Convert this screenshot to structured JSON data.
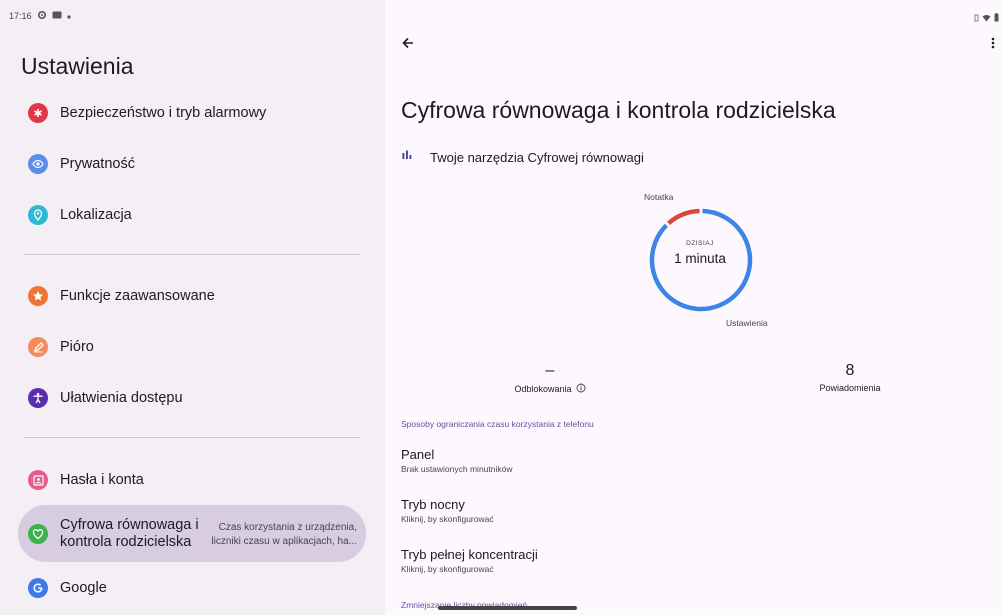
{
  "status_bar": {
    "time": "17:16"
  },
  "settings": {
    "title": "Ustawienia",
    "items": [
      {
        "label": "Bezpieczeństwo i tryb alarmowy",
        "icon": "asterisk-icon",
        "color": "#e2364b"
      },
      {
        "label": "Prywatność",
        "icon": "eye-icon",
        "color": "#5b8dea"
      },
      {
        "label": "Lokalizacja",
        "icon": "location-pin-icon",
        "color": "#2eb8d3"
      },
      {
        "label": "Funkcje zaawansowane",
        "icon": "star-icon",
        "color": "#f17532"
      },
      {
        "label": "Pióro",
        "icon": "pen-icon",
        "color": "#f58a5f"
      },
      {
        "label": "Ułatwienia dostępu",
        "icon": "accessibility-icon",
        "color": "#5b2bb0"
      },
      {
        "label": "Hasła i konta",
        "icon": "account-box-icon",
        "color": "#ea5b8d"
      },
      {
        "label": "Cyfrowa równowaga i kontrola rodzicielska",
        "icon": "heart-leaf-icon",
        "color": "#3bb34a",
        "subtitle": "Czas korzystania z urządzenia, liczniki czasu w aplikacjach, ha...",
        "selected": true
      },
      {
        "label": "Google",
        "icon": "google-icon",
        "color": "#3b7ae8"
      }
    ]
  },
  "detail": {
    "title": "Cyfrowa równowaga i kontrola rodzicielska",
    "tools_label": "Twoje narzędzia Cyfrowej równowagi",
    "chart_data": {
      "type": "pie",
      "center_caption": "DZISIAJ",
      "center_value": "1 minuta",
      "slices": [
        {
          "label": "Notatka",
          "value": 0.12,
          "color": "#d9473f"
        },
        {
          "label": "Ustawienia",
          "value": 0.88,
          "color": "#3c84e6"
        }
      ]
    },
    "stats": {
      "unlocks_value": "–",
      "unlocks_label": "Odblokowania",
      "notifications_value": "8",
      "notifications_label": "Powiadomienia"
    },
    "section_limits": "Sposoby ograniczania czasu korzystania z telefonu",
    "rows": [
      {
        "title": "Panel",
        "subtitle": "Brak ustawionych minutników"
      },
      {
        "title": "Tryb nocny",
        "subtitle": "Kliknij, by skonfigurować"
      },
      {
        "title": "Tryb pełnej koncentracji",
        "subtitle": "Kliknij, by skonfigurować"
      }
    ],
    "section_notifications": "Zmniejszanie liczby powiadomień"
  }
}
